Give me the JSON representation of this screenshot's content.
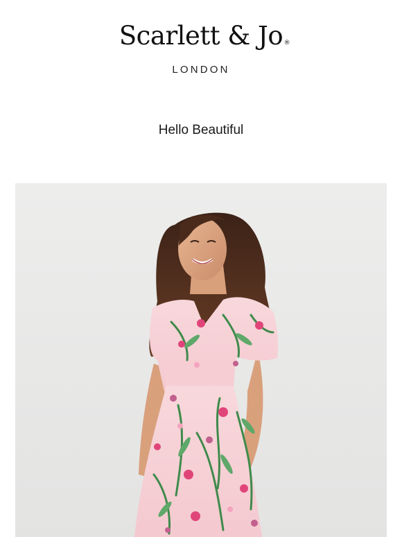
{
  "brand": {
    "name": "Scarlett & Jo",
    "registered_mark": "®",
    "location": "LONDON"
  },
  "greeting": "Hello Beautiful",
  "hero": {
    "image_icon": "model-floral-dress-photo",
    "background_color": "#eaeae9",
    "dress_base_color": "#f7d4d8",
    "print_colors": [
      "#3f8a4b",
      "#e0457a",
      "#c2608e"
    ]
  }
}
